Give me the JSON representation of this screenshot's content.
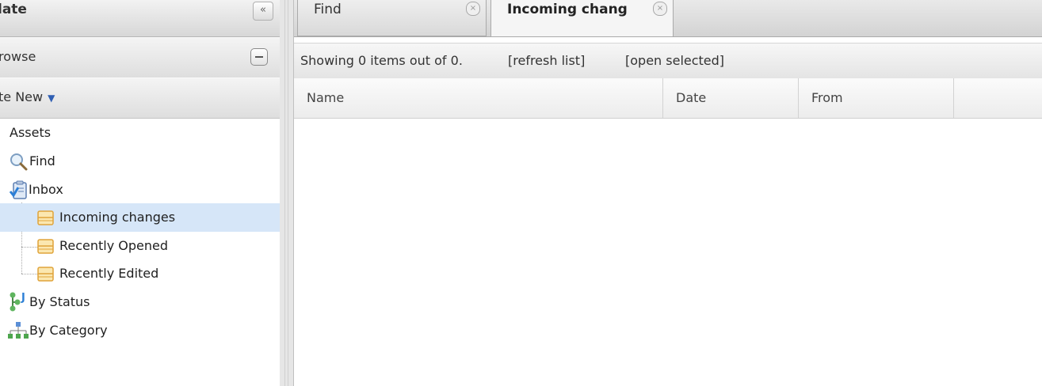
{
  "left_panel": {
    "header_title": "late",
    "collapse_glyph": "«",
    "browse_label": "rowse",
    "create_new_label": "te New",
    "create_new_caret": "▼",
    "tree": {
      "root": "Assets",
      "find": "Find",
      "inbox": "Inbox",
      "inbox_children": [
        "Incoming changes",
        "Recently Opened",
        "Recently Edited"
      ],
      "by_status": "By Status",
      "by_category": "By Category"
    }
  },
  "tabs": [
    {
      "label": "Find",
      "close": "×"
    },
    {
      "label": "Incoming chang",
      "close": "×"
    }
  ],
  "toolbar": {
    "status": "Showing 0 items out of 0.",
    "refresh": "[refresh list]",
    "open_selected": "[open selected]"
  },
  "columns": [
    "Name",
    "Date",
    "From"
  ],
  "icons": {
    "find": "magnifier-icon",
    "inbox": "clipboard-check-icon",
    "inbox_item": "tray-icon",
    "by_status": "status-tree-icon",
    "by_category": "category-hierarchy-icon"
  },
  "colors": {
    "selected_row": "#d6e6f8",
    "caret_blue": "#2f5fb3",
    "tray_yellow": "#e8b347"
  }
}
